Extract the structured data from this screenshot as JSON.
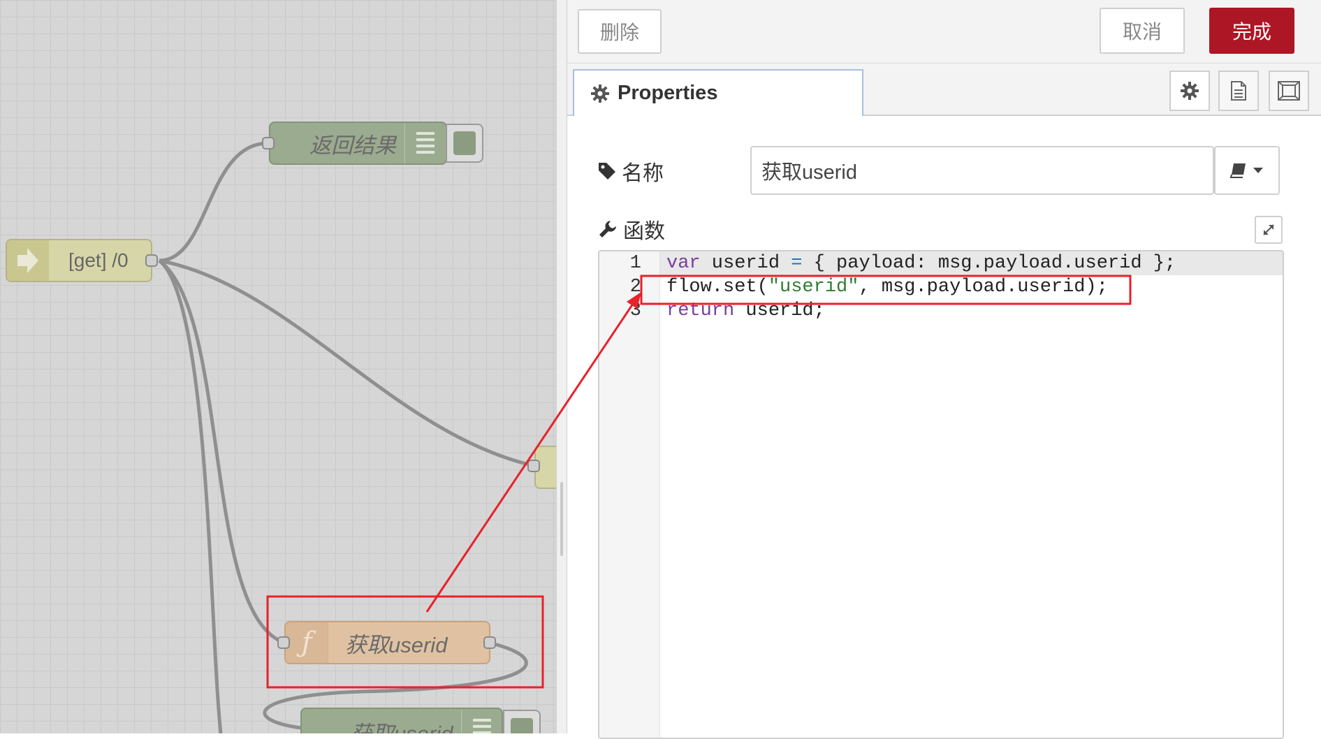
{
  "workspace": {
    "nodes": {
      "http_in": {
        "label": "[get] /0"
      },
      "return_result": {
        "label": "返回结果"
      },
      "get_userid": {
        "label": "获取userid"
      },
      "get_userid_debug": {
        "label": "获取userid"
      }
    }
  },
  "tray": {
    "header": {
      "delete_label": "删除",
      "cancel_label": "取消",
      "done_label": "完成"
    },
    "tabs": {
      "properties_label": "Properties"
    },
    "form": {
      "name_label": "名称",
      "name_value": "获取userid",
      "function_label": "函数"
    },
    "code": {
      "line_numbers": [
        "1",
        "2",
        "3"
      ],
      "lines": [
        "var userid = { payload: msg.payload.userid };",
        "flow.set(\"userid\", msg.payload.userid);",
        "return userid;"
      ]
    }
  },
  "colors": {
    "done_button": "#ad1625",
    "highlight_box": "#e8212b",
    "function_node": "#e0c2a3",
    "debug_node": "#9bab8f",
    "http_node": "#d7d6a8"
  }
}
